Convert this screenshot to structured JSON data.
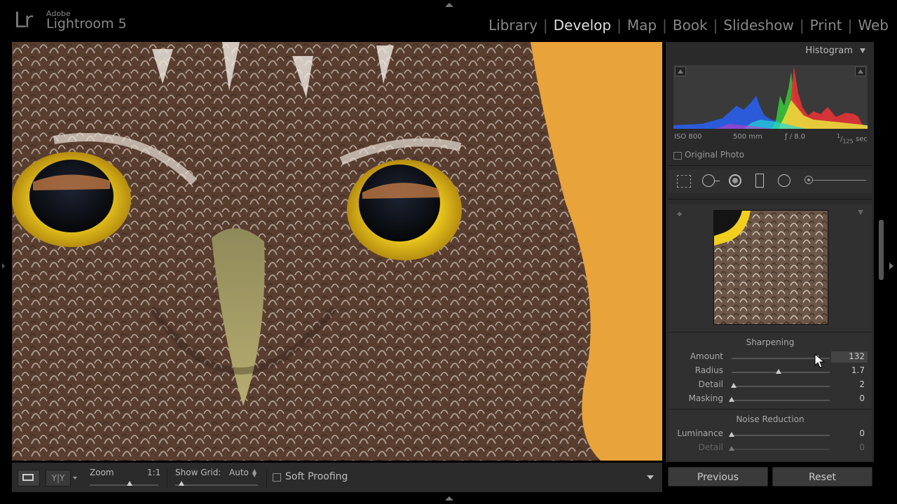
{
  "app": {
    "logo_text": "Lr",
    "brand_top": "Adobe",
    "brand_name": "Lightroom 5"
  },
  "modules": [
    "Library",
    "Develop",
    "Map",
    "Book",
    "Slideshow",
    "Print",
    "Web"
  ],
  "active_module": "Develop",
  "histogram": {
    "title": "Histogram",
    "iso": "ISO 800",
    "focal": "500 mm",
    "aperture": "ƒ / 8.0",
    "shutter_num": "1",
    "shutter_den": "125",
    "shutter_unit": "sec",
    "original_photo_label": "Original Photo"
  },
  "detail": {
    "sharpening_title": "Sharpening",
    "sharpening": [
      {
        "label": "Amount",
        "value": "132",
        "level": 0.88
      },
      {
        "label": "Radius",
        "value": "1.7",
        "level": 0.48
      },
      {
        "label": "Detail",
        "value": "2",
        "level": 0.02
      },
      {
        "label": "Masking",
        "value": "0",
        "level": 0.0
      }
    ],
    "noise_title": "Noise Reduction",
    "noise": [
      {
        "label": "Luminance",
        "value": "0",
        "level": 0.0
      },
      {
        "label": "Detail",
        "value": "0",
        "level": 0.0
      }
    ]
  },
  "toolbar": {
    "zoom_label": "Zoom",
    "zoom_value": "1:1",
    "grid_label": "Show Grid:",
    "grid_value": "Auto",
    "soft_proofing_label": "Soft Proofing"
  },
  "buttons": {
    "previous": "Previous",
    "reset": "Reset"
  },
  "colors": {
    "background": "#e8a33a",
    "iris": "#f2cf1f",
    "panel": "#2a2a2a"
  }
}
